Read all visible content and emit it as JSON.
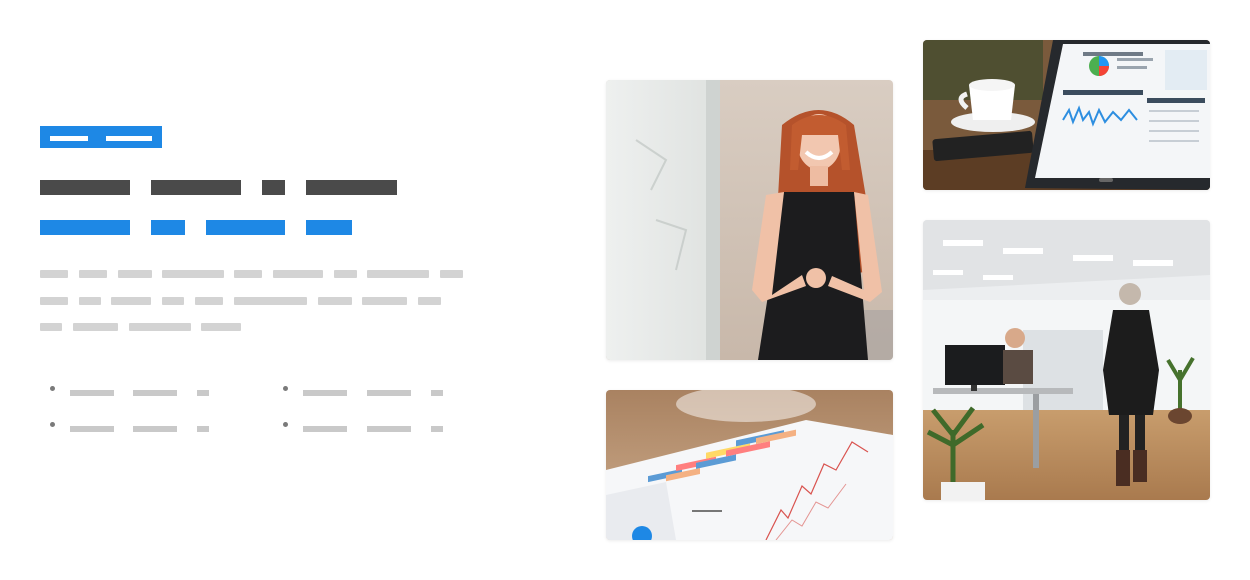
{
  "colors": {
    "accent": "#1e88e5",
    "heading": "#4a4a4a",
    "placeholder": "#d3d3d3"
  },
  "hero": {
    "tag_placeholder": "redacted-label",
    "headline_placeholder": "redacted-heading",
    "subheadline_placeholder": "redacted-subheading",
    "paragraph_placeholder": "redacted-body-text",
    "bullet_list_placeholder": "redacted-feature-list"
  },
  "gallery": {
    "images": [
      {
        "name": "presenter-at-whiteboard"
      },
      {
        "name": "tablet-analytics-dashboard"
      },
      {
        "name": "printed-bar-chart-report"
      },
      {
        "name": "open-plan-office"
      }
    ]
  }
}
